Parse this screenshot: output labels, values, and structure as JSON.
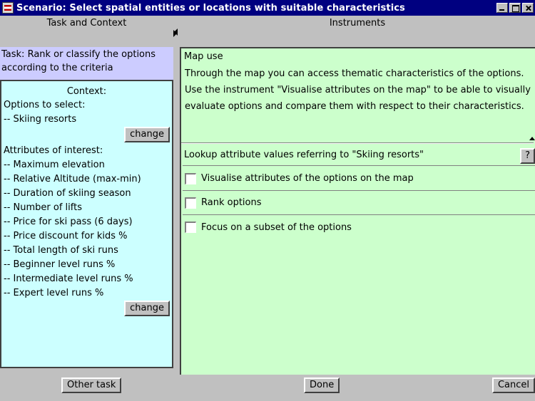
{
  "window": {
    "title": "Scenario: Select spatial entities or locations with suitable characteristics",
    "app_icon": "application-icon"
  },
  "left": {
    "header": "Task and Context",
    "task": "Task: Rank or classify the options according to the criteria",
    "context": {
      "title": "Context:",
      "options_label": "Options to select:",
      "options": [
        "-- Skiing resorts"
      ],
      "change_options_label": "change",
      "attributes_label": "Attributes of interest:",
      "attributes": [
        "-- Maximum elevation",
        "-- Relative Altitude (max-min)",
        "-- Duration of skiing season",
        "-- Number of lifts",
        "-- Price for ski pass (6 days)",
        "-- Price discount for kids %",
        "-- Total length of ski runs",
        "-- Beginner level runs %",
        "-- Intermediate level runs %",
        "-- Expert level runs %"
      ],
      "change_attributes_label": "change"
    },
    "other_task_label": "Other task"
  },
  "right": {
    "header": "Instruments",
    "map_use": {
      "title": "Map use",
      "text": "Through the map you can access thematic characteristics of the options. Use the instrument \"Visualise attributes on the map\" to be able to visually evaluate options and compare them with respect to their characteristics."
    },
    "lookup_label": "Lookup attribute values referring to \"Skiing resorts\"",
    "help_label": "?",
    "options": [
      {
        "label": "Visualise attributes of the options on the map",
        "checked": false
      },
      {
        "label": "Rank options",
        "checked": false
      },
      {
        "label": "Focus on a subset of the options",
        "checked": false
      }
    ],
    "done_label": "Done",
    "cancel_label": "Cancel"
  },
  "colors": {
    "title_bar": "#000080",
    "task_bg": "#ccccff",
    "context_bg": "#ccffff",
    "instruments_bg": "#ccffcc",
    "window_bg": "#c0c0c0"
  }
}
